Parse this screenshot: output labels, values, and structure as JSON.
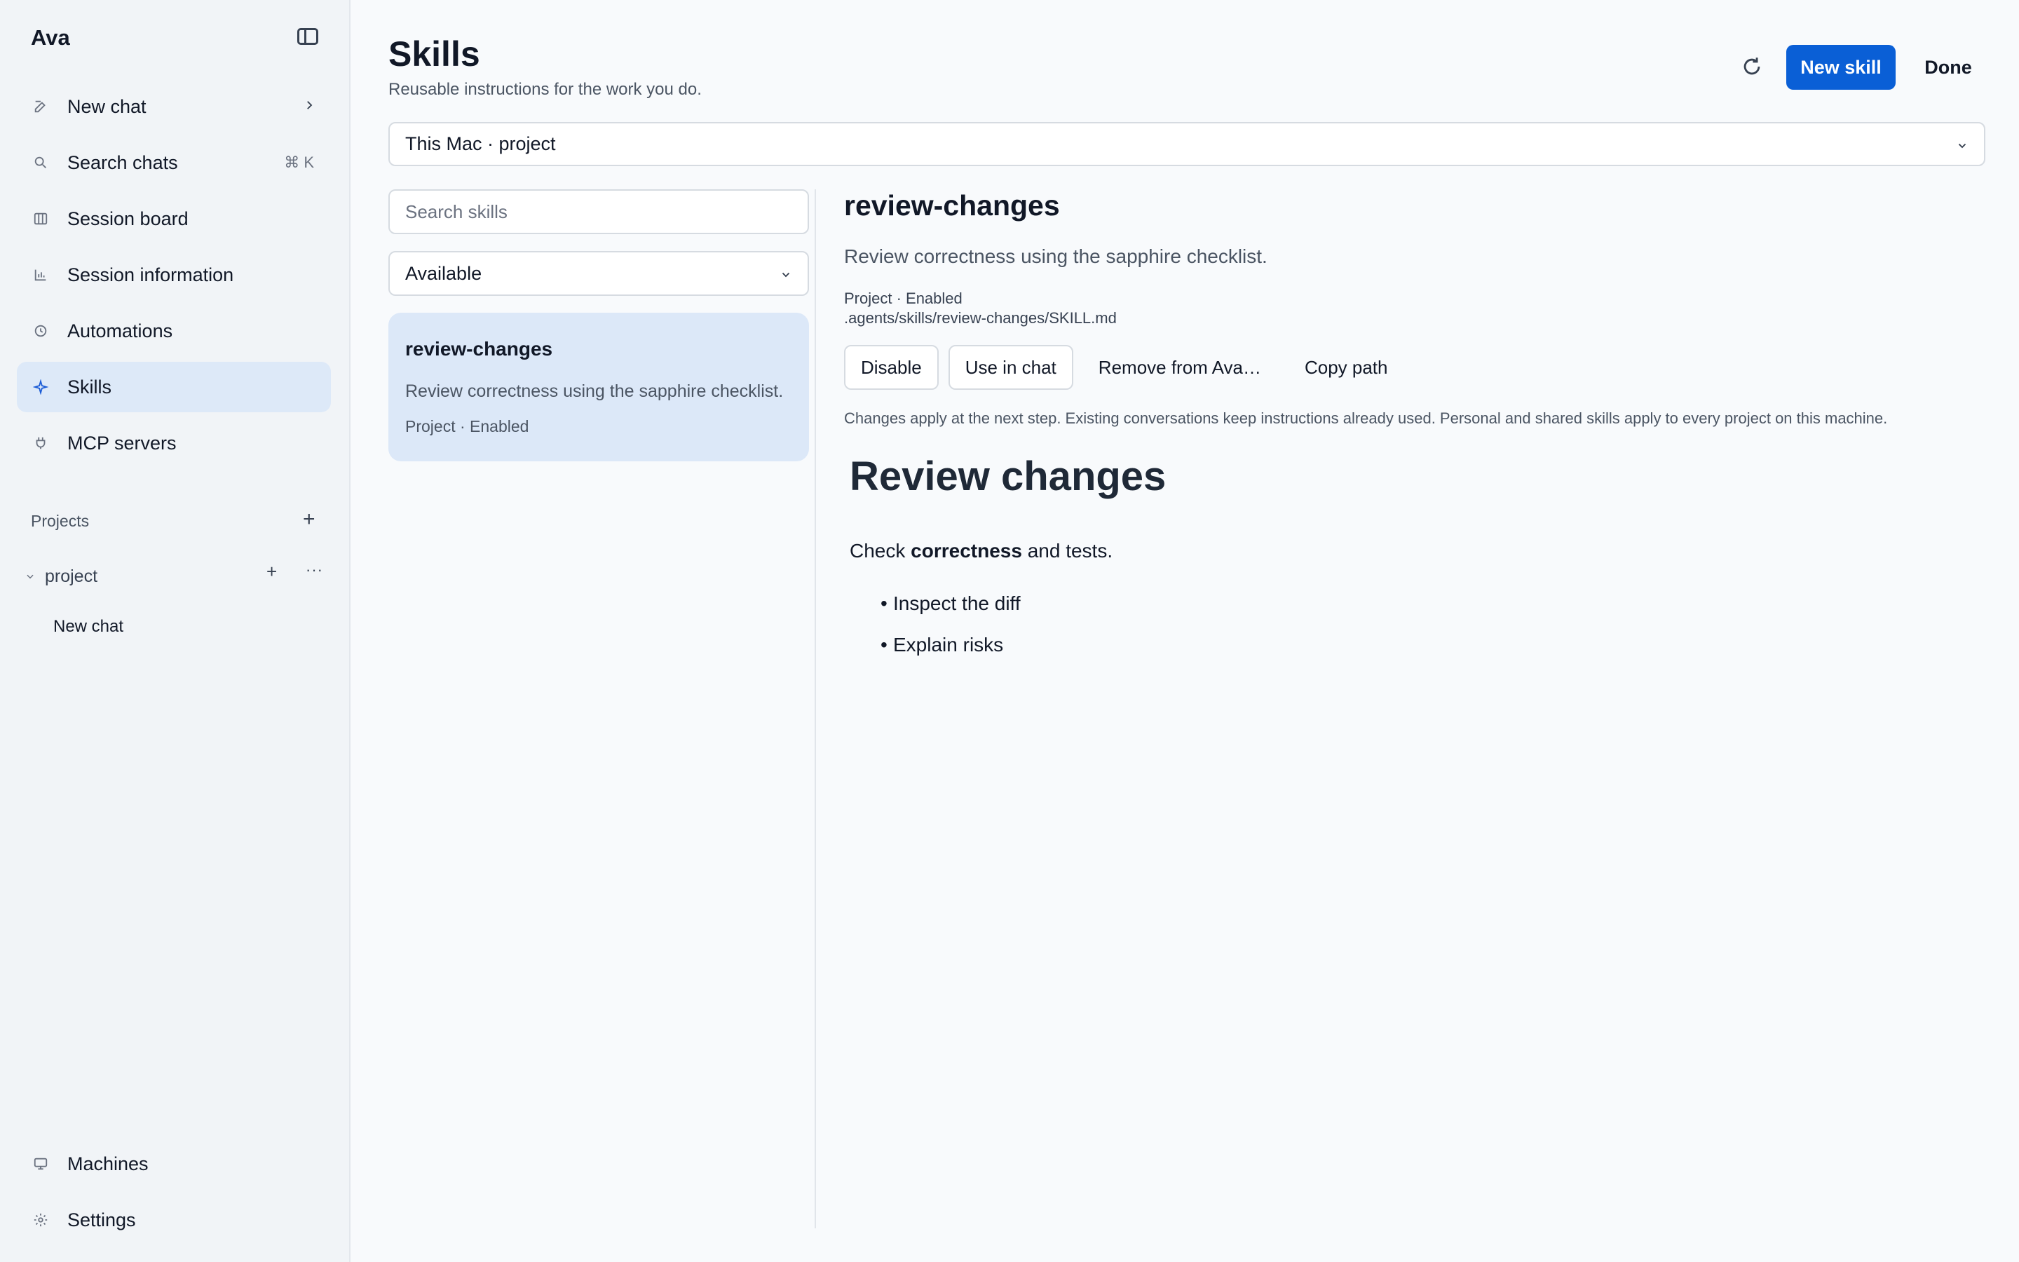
{
  "app": {
    "title": "Ava"
  },
  "sidebar": {
    "items": [
      {
        "label": "New chat",
        "icon": "compose-icon",
        "has_arrow": true
      },
      {
        "label": "Search chats",
        "icon": "search-icon",
        "shortcut": "⌘ K"
      },
      {
        "label": "Session board",
        "icon": "board-icon"
      },
      {
        "label": "Session information",
        "icon": "chart-icon"
      },
      {
        "label": "Automations",
        "icon": "clock-icon"
      },
      {
        "label": "Skills",
        "icon": "sparkle-icon",
        "active": true
      },
      {
        "label": "MCP servers",
        "icon": "plug-icon"
      }
    ],
    "projects_label": "Projects",
    "project": {
      "name": "project",
      "chats": [
        "New chat"
      ]
    },
    "bottom_items": [
      {
        "label": "Machines",
        "icon": "monitor-icon"
      },
      {
        "label": "Settings",
        "icon": "gear-icon"
      }
    ]
  },
  "header": {
    "title": "Skills",
    "subtitle": "Reusable instructions for the work you do.",
    "new_skill_label": "New skill",
    "done_label": "Done"
  },
  "scope_select": {
    "value": "This Mac · project"
  },
  "skills_list": {
    "search_placeholder": "Search skills",
    "filter_value": "Available",
    "items": [
      {
        "name": "review-changes",
        "description": "Review correctness using the sapphire checklist.",
        "meta": "Project · Enabled",
        "selected": true
      }
    ]
  },
  "detail": {
    "name": "review-changes",
    "description": "Review correctness using the sapphire checklist.",
    "status": "Project · Enabled",
    "path": ".agents/skills/review-changes/SKILL.md",
    "actions": {
      "disable": "Disable",
      "use_in_chat": "Use in chat",
      "remove": "Remove from Ava…",
      "copy_path": "Copy path"
    },
    "notice": "Changes apply at the next step. Existing conversations keep instructions already used. Personal and shared skills apply to every project on this machine.",
    "content": {
      "heading": "Review changes",
      "para_before": "Check ",
      "para_bold": "correctness",
      "para_after": " and tests.",
      "bullets": [
        "Inspect the diff",
        "Explain risks"
      ]
    }
  },
  "colors": {
    "accent": "#0a5fd6",
    "active_bg": "#dde9f8"
  }
}
